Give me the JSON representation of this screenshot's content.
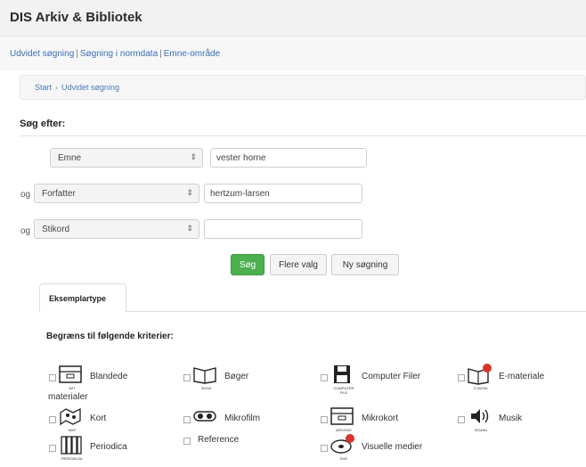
{
  "app": {
    "title": "DIS Arkiv & Bibliotek"
  },
  "topnav": {
    "items": [
      "Udvidet søgning",
      "Søgning i normdata",
      "Emne-område"
    ]
  },
  "breadcrumb": {
    "start": "Start",
    "current": "Udvidet søgning"
  },
  "search": {
    "heading": "Søg efter:",
    "rows": [
      {
        "prefix": "",
        "field": "Emne",
        "value": "vester horne"
      },
      {
        "prefix": "og",
        "field": "Forfatter",
        "value": "hertzum-larsen"
      },
      {
        "prefix": "og",
        "field": "Stikord",
        "value": ""
      }
    ],
    "arrow_glyph": "⇕",
    "buttons": {
      "search": "Søg",
      "more": "Flere valg",
      "new": "Ny søgning"
    }
  },
  "tabs": {
    "active": "Eksemplartype"
  },
  "criteria": {
    "heading": "Begræns til følgende kriterier:",
    "items": [
      {
        "label": "Blandede",
        "label_cont": "materialer",
        "caption": "MIT",
        "icon": "archive-box-icon"
      },
      {
        "label": "Bøger",
        "caption": "BOOK",
        "icon": "book-icon"
      },
      {
        "label": "Computer Filer",
        "caption": "COMPUTER FILE",
        "icon": "floppy-disk-icon"
      },
      {
        "label": "E-materiale",
        "caption": "E-BOOK",
        "icon": "ebook-icon"
      },
      {
        "label": "Kort",
        "caption": "MAP",
        "icon": "map-icon"
      },
      {
        "label": "Mikrofilm",
        "caption": "",
        "icon": "microfilm-icon"
      },
      {
        "label": "Mikrokort",
        "caption": "ARCHIVE",
        "icon": "microcard-icon"
      },
      {
        "label": "Musik",
        "caption": "SOUND",
        "icon": "speaker-icon"
      },
      {
        "label": "Periodica",
        "caption": "PERIODICAL",
        "icon": "periodical-icon"
      },
      {
        "label": "Reference",
        "caption": "",
        "icon": ""
      },
      {
        "label": "Visuelle medier",
        "caption": "DVD",
        "icon": "disc-icon"
      }
    ]
  },
  "colors": {
    "accent_green": "#4caf50",
    "link_blue": "#3b6fb6"
  }
}
